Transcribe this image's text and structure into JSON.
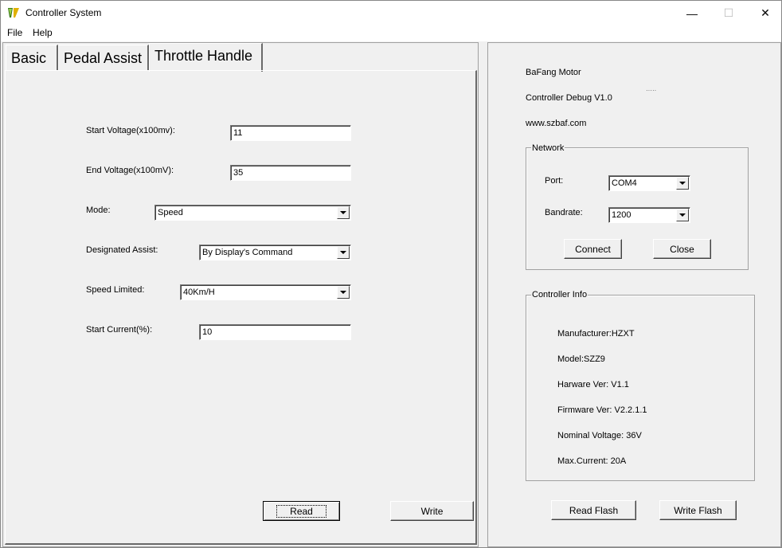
{
  "window": {
    "title": "Controller System",
    "controls": {
      "minimize": "—",
      "maximize": "☐",
      "close": "✕"
    }
  },
  "menu": {
    "file": "File",
    "help": "Help"
  },
  "tabs": {
    "basic": "Basic",
    "pedal_assist": "Pedal Assist",
    "throttle_handle": "Throttle Handle"
  },
  "throttle": {
    "start_voltage": {
      "label": "Start Voltage(x100mv):",
      "value": "11"
    },
    "end_voltage": {
      "label": "End Voltage(x100mV):",
      "value": "35"
    },
    "mode": {
      "label": "Mode:",
      "value": "Speed"
    },
    "designated_assist": {
      "label": "Designated Assist:",
      "value": "By Display's Command"
    },
    "speed_limited": {
      "label": "Speed Limited:",
      "value": "40Km/H"
    },
    "start_current": {
      "label": "Start Current(%):",
      "value": "10"
    },
    "read_label": "Read",
    "write_label": "Write"
  },
  "about": {
    "brand": "BaFang Motor",
    "version": "Controller Debug V1.0",
    "website": "www.szbaf.com",
    "marker": "·····"
  },
  "network": {
    "title": "Network",
    "port_label": "Port:",
    "port_value": "COM4",
    "bandrate_label": "Bandrate:",
    "bandrate_value": "1200",
    "connect_label": "Connect",
    "close_label": "Close"
  },
  "controller_info": {
    "title": "Controller Info",
    "manufacturer": "Manufacturer:HZXT",
    "model": "Model:SZZ9",
    "hardware": "Harware Ver: V1.1",
    "firmware": "Firmware Ver: V2.2.1.1",
    "nominal_voltage": "Nominal Voltage: 36V",
    "max_current": "Max.Current: 20A"
  },
  "flash": {
    "read_label": "Read Flash",
    "write_label": "Write Flash"
  }
}
